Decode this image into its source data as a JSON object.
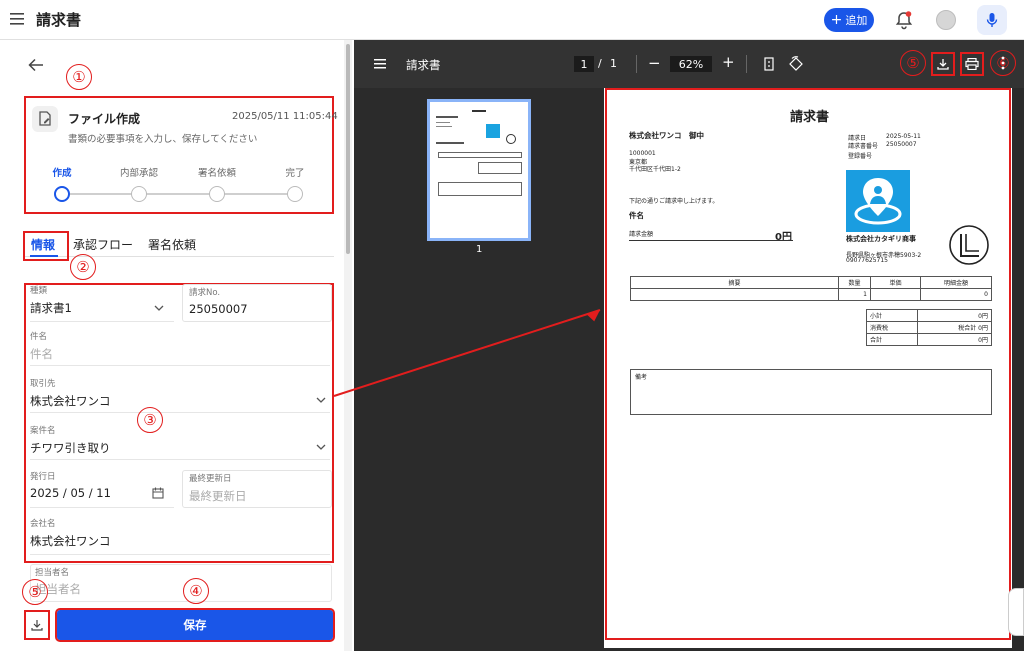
{
  "header": {
    "title": "請求書",
    "add_label": "追加"
  },
  "card": {
    "title": "ファイル作成",
    "date": "2025/05/11 11:05:44",
    "description": "書類の必要事項を入力し、保存してください",
    "steps": [
      "作成",
      "内部承認",
      "署名依頼",
      "完了"
    ],
    "active_step": 0
  },
  "tabs": [
    "情報",
    "承認フロー",
    "署名依頼"
  ],
  "form": {
    "type_label": "種類",
    "type_value": "請求書1",
    "invoice_no_label": "請求No.",
    "invoice_no_value": "25050007",
    "subject_label": "件名",
    "subject_placeholder": "件名",
    "client_label": "取引先",
    "client_value": "株式会社ワンコ",
    "project_label": "案件名",
    "project_value": "チワワ引き取り",
    "issue_date_label": "発行日",
    "issue_date_value": "2025 / 05 / 11",
    "updated_label": "最終更新日",
    "updated_placeholder": "最終更新日",
    "company_label": "会社名",
    "company_value": "株式会社ワンコ",
    "person_label": "担当者名",
    "person_placeholder": "担当者名"
  },
  "save_label": "保存",
  "viewer": {
    "title": "請求書",
    "page_current": "1",
    "page_sep": "/",
    "page_total": "1",
    "zoom": "62%",
    "thumb_label": "1"
  },
  "document": {
    "heading": "請求書",
    "recipient": "株式会社ワンコ　御中",
    "postal": "1000001",
    "pref": "東京都",
    "address": "千代田区千代田1-2",
    "meta_labels": [
      "請求日",
      "請求書番号",
      "登録番号"
    ],
    "meta_values": [
      "2025-05-11",
      "25050007",
      ""
    ],
    "intro": "下記の通りご請求申し上げます。",
    "subject_label": "件名",
    "amount_label": "請求金額",
    "amount_value": "0円",
    "issuer_name": "株式会社カタギリ商事",
    "issuer_address": "長野県駒ヶ根市赤穂5903-2",
    "issuer_phone": "09077625715",
    "table_headers": [
      "摘要",
      "数量",
      "単価",
      "明細金額"
    ],
    "table_row": [
      "",
      "1",
      "",
      "0"
    ],
    "summary_labels": [
      "小計",
      "消費税",
      "合計"
    ],
    "summary_values": [
      "0円",
      "税合計 0円",
      "0円"
    ],
    "notes_label": "備考"
  },
  "annotations": [
    "①",
    "②",
    "③",
    "④",
    "⑤",
    "⑤",
    "⑥"
  ]
}
